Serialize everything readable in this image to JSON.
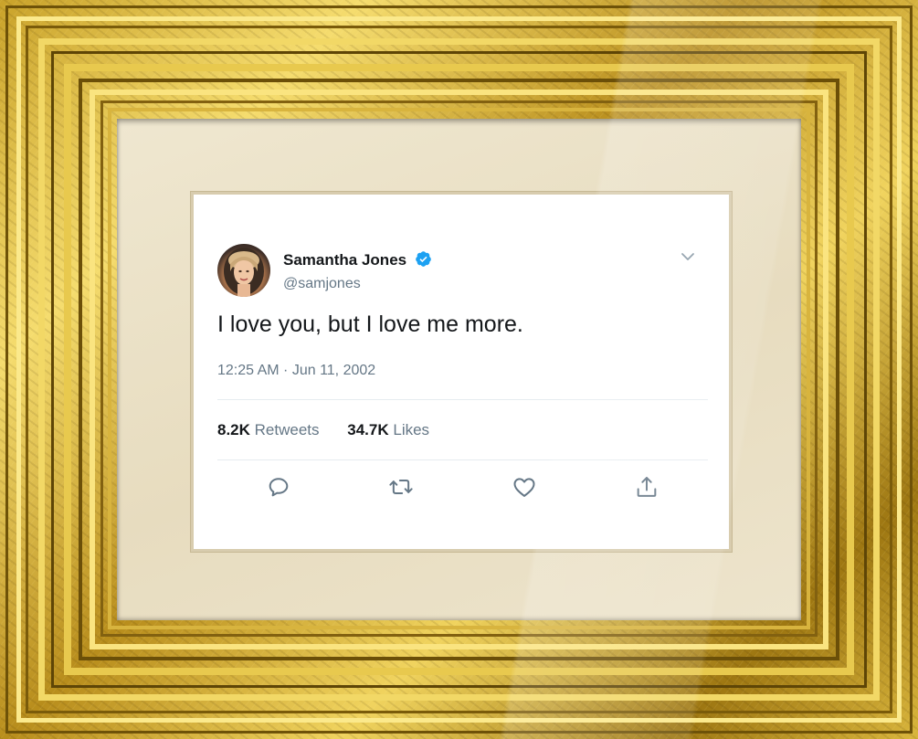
{
  "tweet": {
    "name": "Samantha Jones",
    "handle": "@samjones",
    "text": "I love you, but I love me more.",
    "timestamp": "12:25 AM · Jun 11, 2002",
    "retweets_count": "8.2K",
    "retweets_label": "Retweets",
    "likes_count": "34.7K",
    "likes_label": "Likes",
    "verified_icon": "verified-badge-icon",
    "accent_color": "#1da1f2"
  },
  "actions": {
    "reply_icon": "reply-icon",
    "retweet_icon": "retweet-icon",
    "like_icon": "heart-icon",
    "share_icon": "share-icon",
    "icon_color": "#657786"
  },
  "frame": {
    "style": "ornate gold picture frame with cream mat"
  }
}
